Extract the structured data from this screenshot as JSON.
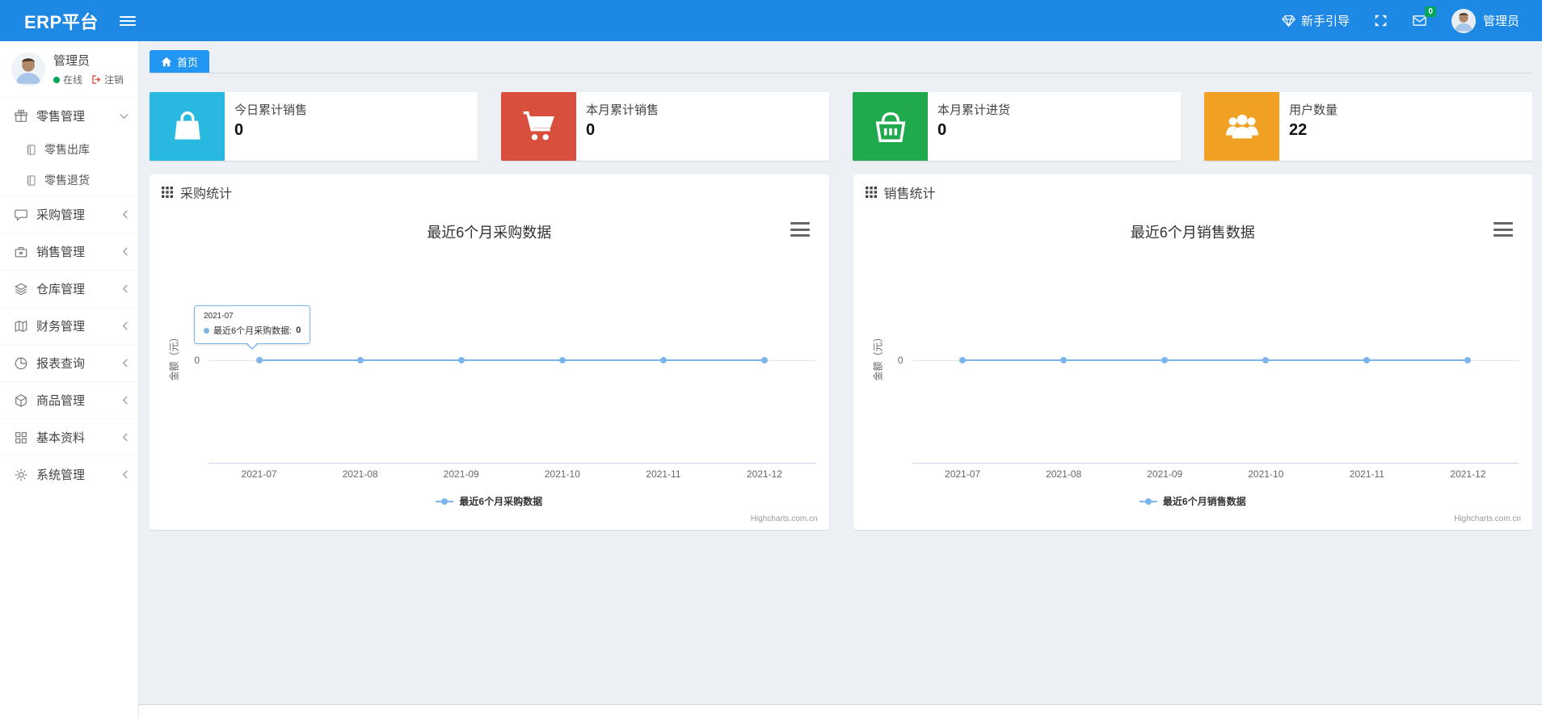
{
  "navbar": {
    "brand": "ERP平台",
    "guide_label": "新手引导",
    "message_badge": "0",
    "user_name": "管理员"
  },
  "sidebar": {
    "user": {
      "name": "管理员",
      "status_label": "在线",
      "logout_label": "注销"
    },
    "menu": [
      {
        "label": "零售管理",
        "icon": "gift-icon",
        "state": "expanded",
        "children": [
          {
            "label": "零售出库",
            "icon": "journal-icon"
          },
          {
            "label": "零售退货",
            "icon": "journal-icon"
          }
        ]
      },
      {
        "label": "采购管理",
        "icon": "comment-icon",
        "state": "collapsed"
      },
      {
        "label": "销售管理",
        "icon": "briefcase-icon",
        "state": "collapsed"
      },
      {
        "label": "仓库管理",
        "icon": "layers-icon",
        "state": "collapsed"
      },
      {
        "label": "财务管理",
        "icon": "map-icon",
        "state": "collapsed"
      },
      {
        "label": "报表查询",
        "icon": "pie-chart-icon",
        "state": "collapsed"
      },
      {
        "label": "商品管理",
        "icon": "cube-icon",
        "state": "collapsed"
      },
      {
        "label": "基本资料",
        "icon": "grid-icon",
        "state": "collapsed"
      },
      {
        "label": "系统管理",
        "icon": "gear-icon",
        "state": "collapsed"
      }
    ]
  },
  "tabs": {
    "home_label": "首页"
  },
  "stat_cards": [
    {
      "label": "今日累计销售",
      "value": "0",
      "color": "#29b8e0",
      "icon": "shopping-bag-icon"
    },
    {
      "label": "本月累计销售",
      "value": "0",
      "color": "#d94f3d",
      "icon": "cart-icon"
    },
    {
      "label": "本月累计进货",
      "value": "0",
      "color": "#21a94d",
      "icon": "basket-icon"
    },
    {
      "label": "用户数量",
      "value": "22",
      "color": "#f0a023",
      "icon": "users-icon"
    }
  ],
  "chart_data": [
    {
      "type": "line",
      "panel_title": "采购统计",
      "title": "最近6个月采购数据",
      "categories": [
        "2021-07",
        "2021-08",
        "2021-09",
        "2021-10",
        "2021-11",
        "2021-12"
      ],
      "series": [
        {
          "name": "最近6个月采购数据",
          "values": [
            0,
            0,
            0,
            0,
            0,
            0
          ],
          "color": "#7cb5ec"
        }
      ],
      "xlabel": "",
      "ylabel": "金额（元）",
      "ytick_labels": [
        "0"
      ],
      "grid": true,
      "legend_position": "bottom",
      "credit": "Highcharts.com.cn",
      "tooltip": {
        "header": "2021-07",
        "series_label": "最近6个月采购数据: ",
        "value": "0"
      }
    },
    {
      "type": "line",
      "panel_title": "销售统计",
      "title": "最近6个月销售数据",
      "categories": [
        "2021-07",
        "2021-08",
        "2021-09",
        "2021-10",
        "2021-11",
        "2021-12"
      ],
      "series": [
        {
          "name": "最近6个月销售数据",
          "values": [
            0,
            0,
            0,
            0,
            0,
            0
          ],
          "color": "#7cb5ec"
        }
      ],
      "xlabel": "",
      "ylabel": "金额（元）",
      "ytick_labels": [
        "0"
      ],
      "grid": true,
      "legend_position": "bottom",
      "credit": "Highcharts.com.cn"
    }
  ]
}
